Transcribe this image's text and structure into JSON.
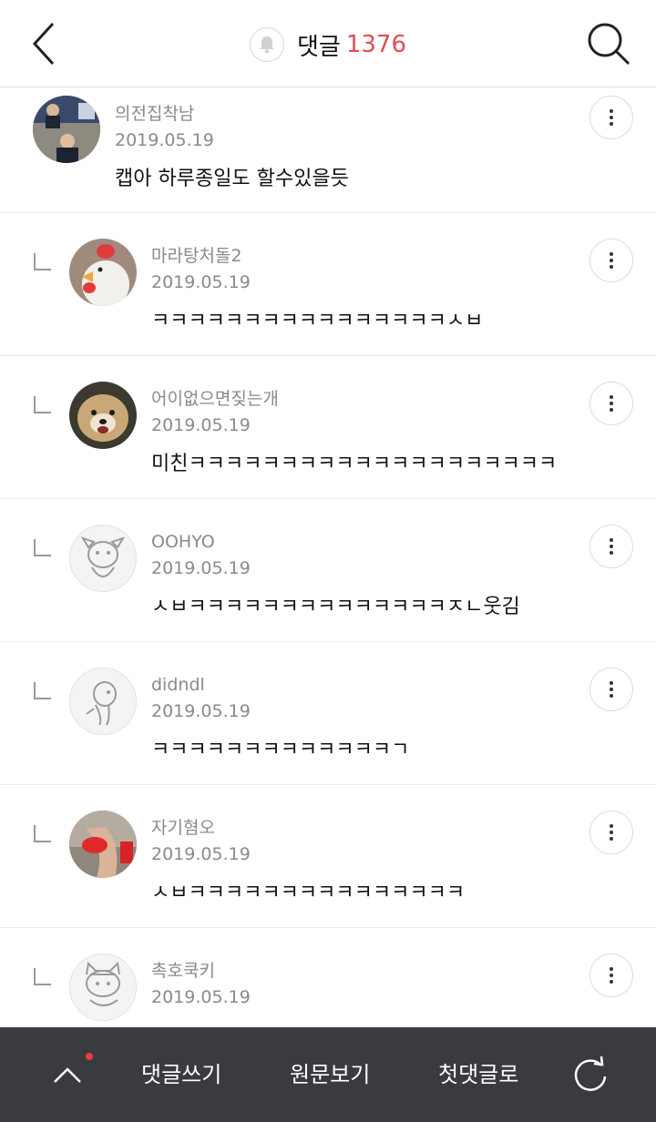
{
  "header": {
    "title": "댓글",
    "count": "1376",
    "back_icon": "chevron-left-icon",
    "bell_icon": "bell-icon",
    "search_icon": "search-icon"
  },
  "comments": [
    {
      "nickname": "의전집착남",
      "date": "2019.05.19",
      "text": "캡아 하루종일도 할수있을듯",
      "avatar": "photo-men-suits"
    },
    {
      "nickname": "마라탕처돌2",
      "date": "2019.05.19",
      "text": "ㅋㅋㅋㅋㅋㅋㅋㅋㅋㅋㅋㅋㅋㅋㅋㅋㅅㅂ",
      "avatar": "chicken-plush"
    },
    {
      "nickname": "어이없으면짖는개",
      "date": "2019.05.19",
      "text": "미친ㅋㅋㅋㅋㅋㅋㅋㅋㅋㅋㅋㅋㅋㅋㅋㅋㅋㅋㅋㅋ",
      "avatar": "dog-photo"
    },
    {
      "nickname": "OOHYO",
      "date": "2019.05.19",
      "text": "ㅅㅂㅋㅋㅋㅋㅋㅋㅋㅋㅋㅋㅋㅋㅋㅋㅈㄴ웃김",
      "avatar": "default-dog-character"
    },
    {
      "nickname": "didndl",
      "date": "2019.05.19",
      "text": "ㅋㅋㅋㅋㅋㅋㅋㅋㅋㅋㅋㅋㅋㄱ",
      "avatar": "default-character"
    },
    {
      "nickname": "자기혐오",
      "date": "2019.05.19",
      "text": "ㅅㅂㅋㅋㅋㅋㅋㅋㅋㅋㅋㅋㅋㅋㅋㅋㅋ",
      "avatar": "photo-red"
    },
    {
      "nickname": "촉호쿡키",
      "date": "2019.05.19",
      "text": "",
      "avatar": "default-cat-character"
    }
  ],
  "bottom_bar": {
    "scroll_up_icon": "chevron-up-icon",
    "write_label": "댓글쓰기",
    "original_label": "원문보기",
    "first_label": "첫댓글로",
    "refresh_icon": "refresh-icon"
  },
  "colors": {
    "accent": "#e04e52",
    "bottom_bar_bg": "#3a3b3f",
    "meta_text": "#8a8a8a"
  }
}
